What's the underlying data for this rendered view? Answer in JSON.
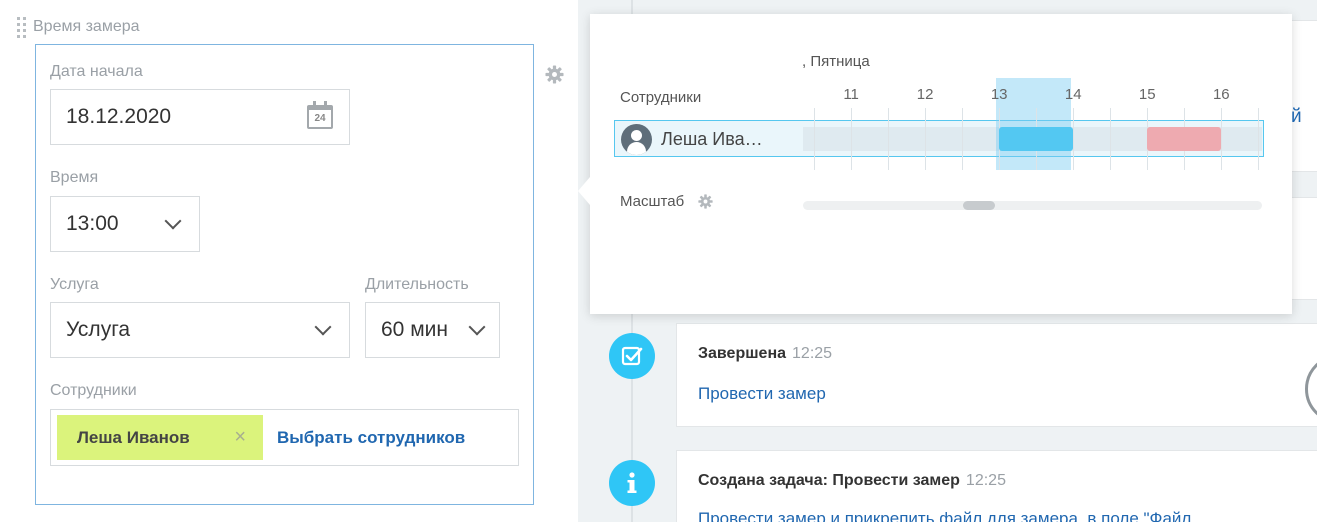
{
  "section": {
    "title": "Время замера"
  },
  "form": {
    "start_date_label": "Дата начала",
    "start_date_value": "18.12.2020",
    "calendar_day": "24",
    "time_label": "Время",
    "time_value": "13:00",
    "service_label": "Услуга",
    "service_value": "Услуга",
    "duration_label": "Длительность",
    "duration_value": "60 мин",
    "employees_label": "Сотрудники",
    "employee_tag": "Леша Иванов",
    "employee_remove": "×",
    "pick_employees": "Выбрать сотрудников"
  },
  "popup": {
    "day_label": ", Пятница",
    "employees_header": "Сотрудники",
    "hours": [
      "11",
      "12",
      "13",
      "14",
      "15",
      "16"
    ],
    "employee_name": "Леша Ива…",
    "scale_label": "Масштаб",
    "slots": [
      {
        "kind": "selected",
        "start": 13,
        "end": 14,
        "color": "#53c8f2"
      },
      {
        "kind": "busy",
        "start": 15,
        "end": 16,
        "color": "#eeaab0"
      }
    ],
    "range": [
      10.35,
      16.55
    ],
    "right_edge_glyph": "й"
  },
  "timeline": [
    {
      "icon": "check-square-icon",
      "title": "Завершена",
      "time": "12:25",
      "link": "Провести замер"
    },
    {
      "icon": "info-icon",
      "title": "Создана задача: Провести замер",
      "time": "12:25",
      "link": "Провести замер и прикрепить файл для замера, в поле \"Файл"
    }
  ],
  "colors": {
    "accent": "#2fc6f6",
    "link": "#2067b0",
    "tag": "#dbf37c",
    "border_focus": "#7fb5e0"
  }
}
